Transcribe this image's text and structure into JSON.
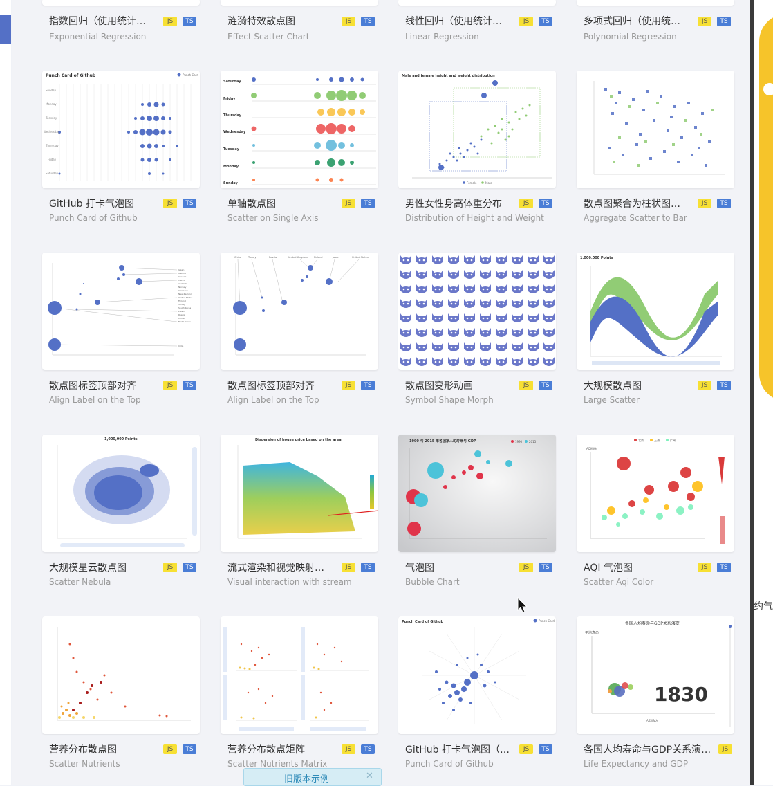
{
  "badges": {
    "js": "JS",
    "ts": "TS"
  },
  "cards": [
    {
      "title": "指数回归（使用统计…",
      "subtitle": "Exponential Regression",
      "js": true,
      "ts": true
    },
    {
      "title": "涟漪特效散点图",
      "subtitle": "Effect Scatter Chart",
      "js": true,
      "ts": true
    },
    {
      "title": "线性回归（使用统计…",
      "subtitle": "Linear Regression",
      "js": true,
      "ts": true
    },
    {
      "title": "多项式回归（使用统…",
      "subtitle": "Polynomial Regression",
      "js": true,
      "ts": true
    },
    {
      "title": "GitHub 打卡气泡图",
      "subtitle": "Punch Card of Github",
      "js": true,
      "ts": true
    },
    {
      "title": "单轴散点图",
      "subtitle": "Scatter on Single Axis",
      "js": true,
      "ts": true
    },
    {
      "title": "男性女性身高体重分布",
      "subtitle": "Distribution of Height and Weight",
      "js": true,
      "ts": true
    },
    {
      "title": "散点图聚合为柱状图…",
      "subtitle": "Aggregate Scatter to Bar",
      "js": true,
      "ts": true
    },
    {
      "title": "散点图标签顶部对齐",
      "subtitle": "Align Label on the Top",
      "js": true,
      "ts": true
    },
    {
      "title": "散点图标签顶部对齐",
      "subtitle": "Align Label on the Top",
      "js": true,
      "ts": true
    },
    {
      "title": "散点图变形动画",
      "subtitle": "Symbol Shape Morph",
      "js": true,
      "ts": true
    },
    {
      "title": "大规模散点图",
      "subtitle": "Large Scatter",
      "js": true,
      "ts": true
    },
    {
      "title": "大规模星云散点图",
      "subtitle": "Scatter Nebula",
      "js": true,
      "ts": true
    },
    {
      "title": "流式渲染和视觉映射…",
      "subtitle": "Visual interaction with stream",
      "js": true,
      "ts": true
    },
    {
      "title": "气泡图",
      "subtitle": "Bubble Chart",
      "js": true,
      "ts": true
    },
    {
      "title": "AQI 气泡图",
      "subtitle": "Scatter Aqi Color",
      "js": true,
      "ts": true
    },
    {
      "title": "营养分布散点图",
      "subtitle": "Scatter Nutrients",
      "js": true,
      "ts": true
    },
    {
      "title": "营养分布散点矩阵",
      "subtitle": "Scatter Nutrients Matrix",
      "js": true,
      "ts": true
    },
    {
      "title": "GitHub 打卡气泡图（…",
      "subtitle": "Punch Card of Github",
      "js": true,
      "ts": true
    },
    {
      "title": "各国人均寿命与GDP关系演…",
      "subtitle": "Life Expectancy and GDP",
      "js": true,
      "ts": false
    }
  ],
  "thumb_text": {
    "punch_title": "Punch Card of Github",
    "punch_legend": "Punch Card",
    "days": [
      "Saturday",
      "Friday",
      "Thursday",
      "Wednesday",
      "Tuesday",
      "Monday",
      "Sunday"
    ],
    "hw_title": "Male and female height and weight distribution",
    "hw_legend": [
      "Female",
      "Male"
    ],
    "large_title": "1,000,000 Points",
    "nebula_title": "1,000,000 Points",
    "stream_title": "Dispersion of house price based on the area",
    "bubble_title": "1990 与 2015 年各国家人均寿命与 GDP",
    "bubble_legend": [
      "1990",
      "2015"
    ],
    "aqi_legend": [
      "北京",
      "上海",
      "广州"
    ],
    "aqi_label": "AQI指数",
    "life_title": "各国人均寿命与GDP关系演变",
    "life_year": "1830",
    "life_ylabel": "平均寿命",
    "life_xlabel": "人均收入",
    "punch_polar_title": "Punch Card of Github",
    "punch_polar_legend": "Punch Card"
  },
  "old_version": {
    "label": "旧版本示例",
    "close": "✕"
  },
  "outside_fragment": "约气",
  "colors": {
    "accent": "#5470c6",
    "green": "#91cc75",
    "yellow": "#fac858",
    "red": "#ee6666",
    "cyan": "#73c0de"
  }
}
